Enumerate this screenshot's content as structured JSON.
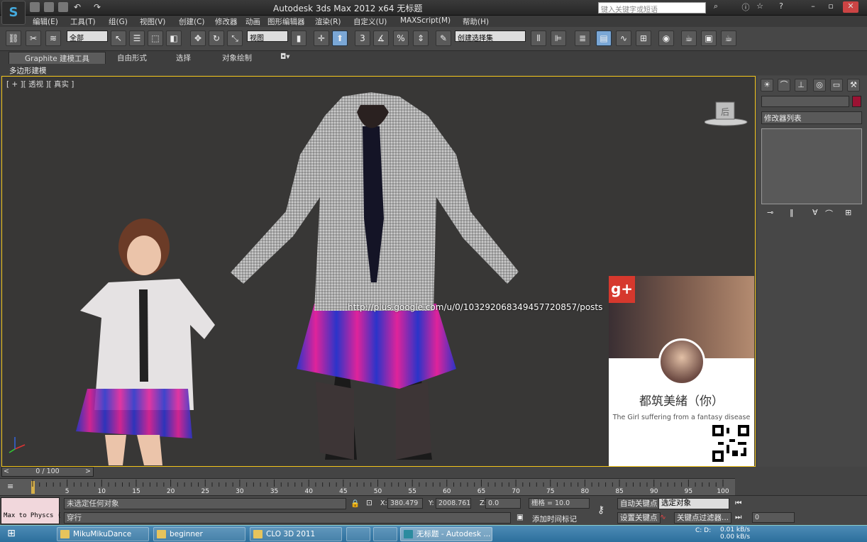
{
  "app": {
    "title": "Autodesk 3ds Max  2012 x64    无标题",
    "search_placeholder": "键入关键字或短语"
  },
  "menu": [
    "编辑(E)",
    "工具(T)",
    "组(G)",
    "视图(V)",
    "创建(C)",
    "修改器",
    "动画",
    "图形编辑器",
    "渲染(R)",
    "自定义(U)",
    "MAXScript(M)",
    "帮助(H)"
  ],
  "toolbar": {
    "selection_filter": "全部",
    "ref_coord": "视图",
    "named_selection": "创建选择集"
  },
  "ribbon": {
    "tabs": [
      "Graphite 建模工具",
      "自由形式",
      "选择",
      "对象绘制"
    ],
    "subpanel": "多边形建模"
  },
  "viewport": {
    "label": "[ + ][ 透视 ][ 真实 ]",
    "viewcube_label": "后"
  },
  "overlay": {
    "url": "http://plus.google.com/u/0/103292068349457720857/posts",
    "card_name": "都筑美緒（你）",
    "card_tagline": "The Girl suffering from a fantasy disease",
    "card_logo": "g+"
  },
  "command_panel": {
    "modifier_list": "修改器列表",
    "color_swatch": "#9b1233"
  },
  "timeline": {
    "time_slider": "0 / 100",
    "ticks": [
      5,
      10,
      15,
      20,
      25,
      30,
      35,
      40,
      45,
      50,
      55,
      60,
      65,
      70,
      75,
      80,
      85,
      90,
      95,
      100
    ]
  },
  "status": {
    "maxscript": "Max to Physcs (",
    "message": "未选定任何对象",
    "prompt": "穿行",
    "x_label": "X:",
    "x_value": "380.479",
    "y_label": "Y:",
    "y_value": "2008.761",
    "z_label": "Z:",
    "z_value": "0.0",
    "grid": "栅格 = 10.0",
    "add_time_tag": "添加时间标记",
    "auto_key": "自动关键点",
    "set_key": "设置关键点",
    "key_mode": "选定对象",
    "key_filters": "关键点过滤器..."
  },
  "taskbar": {
    "items": [
      "MikuMikuDance",
      "beginner",
      "CLO 3D 2011",
      "无标题 - Autodesk ..."
    ],
    "clock_line1": "0.01 kB/s",
    "clock_line2": "0.00 kB/s",
    "drives": "C: D:"
  }
}
